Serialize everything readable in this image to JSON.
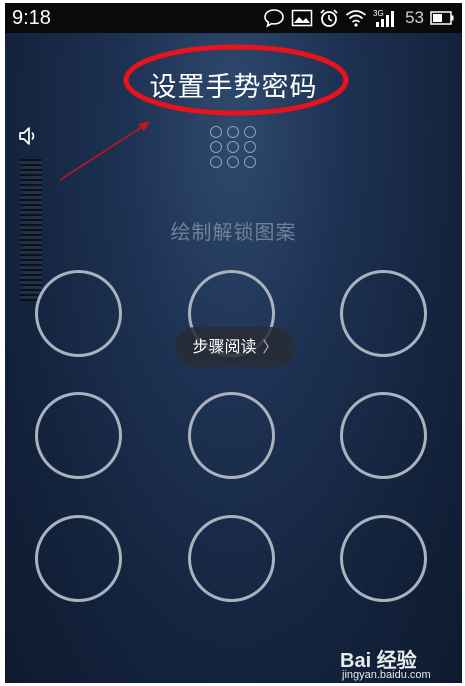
{
  "status_bar": {
    "time": "9:18",
    "battery": "53",
    "signal_label": "3G",
    "icons": [
      "message-icon",
      "image-icon",
      "alarm-icon",
      "wifi-icon",
      "signal-icon",
      "battery-icon"
    ]
  },
  "header": {
    "title": "设置手势密码",
    "annotation_color": "#e8131b"
  },
  "pattern": {
    "subtitle": "绘制解锁图案",
    "nodes": 9
  },
  "overlay": {
    "step_reading": "步骤阅读",
    "chevron": "〉"
  },
  "watermark": {
    "logo": "Bai 经验",
    "url": "jingyan.baidu.com"
  }
}
